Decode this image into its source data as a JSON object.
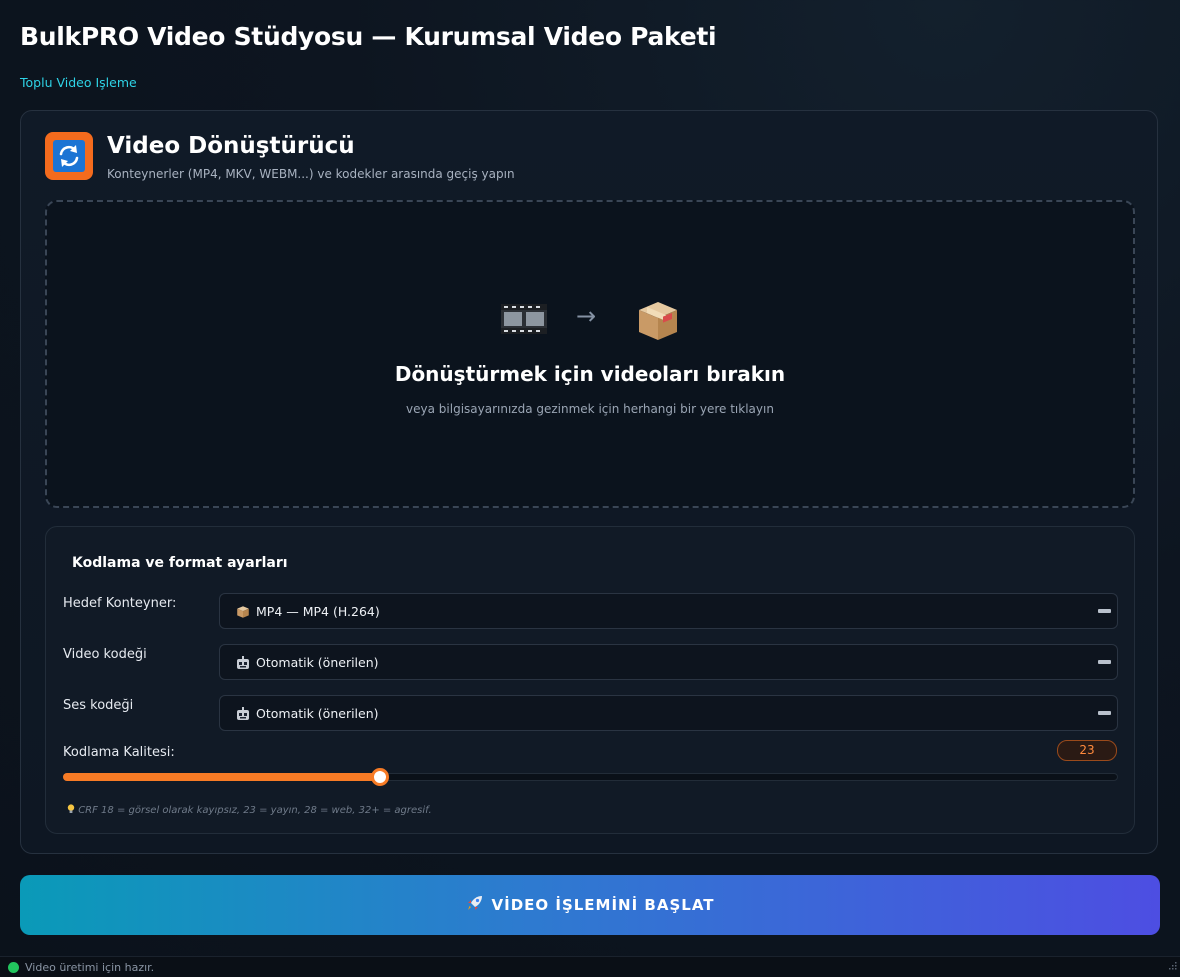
{
  "app": {
    "title": "BulkPRO Video Stüdyosu — Kurumsal Video Paketi",
    "subtitle": "Toplu Video Işleme"
  },
  "tool": {
    "title": "Video Dönüştürücü",
    "description": "Konteynerler (MP4, MKV, WEBM...) ve kodekler arasında geçiş yapın",
    "icon": "convert-arrows-icon"
  },
  "dropzone": {
    "title": "Dönüştürmek için videoları bırakın",
    "hint": "veya bilgisayarınızda gezinmek için herhangi bir yere tıklayın",
    "arrow": "→",
    "icons": [
      "film-strip-icon",
      "arrow-right-icon",
      "package-box-icon"
    ]
  },
  "settings": {
    "title": "Kodlama ve format ayarları",
    "container": {
      "label": "Hedef Konteyner:",
      "value": "MP4 — MP4 (H.264)",
      "icon": "package-box-icon"
    },
    "video_codec": {
      "label": "Video kodeği",
      "value": "Otomatik (önerilen)",
      "icon": "robot-icon"
    },
    "audio_codec": {
      "label": "Ses kodeği",
      "value": "Otomatik (önerilen)",
      "icon": "robot-icon"
    },
    "quality": {
      "label": "Kodlama Kalitesi:",
      "value": "23",
      "fraction": 0.3,
      "hint": "CRF 18 = görsel olarak kayıpsız, 23 = yayın, 28 = web, 32+ = agresif."
    }
  },
  "action": {
    "start_label": "VİDEO İŞLEMİNİ BAŞLAT",
    "icon": "rocket-icon"
  },
  "status": {
    "text": "Video üretimi için hazır.",
    "state_color": "#22c55e"
  },
  "colors": {
    "accent": "#f77b25",
    "link": "#2ed3e6",
    "button_start": "#0a9ab8",
    "button_end": "#4d4ee2"
  }
}
